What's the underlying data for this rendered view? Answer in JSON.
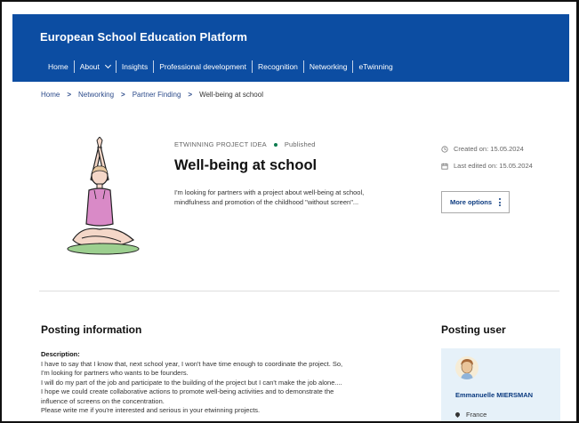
{
  "header": {
    "site_title": "European School Education Platform",
    "nav": [
      {
        "label": "Home"
      },
      {
        "label": "About",
        "has_dropdown": true
      },
      {
        "label": "Insights"
      },
      {
        "label": "Professional development"
      },
      {
        "label": "Recognition"
      },
      {
        "label": "Networking"
      },
      {
        "label": "eTwinning"
      }
    ],
    "brand_color": "#0c4da2"
  },
  "breadcrumb": {
    "items": [
      "Home",
      "Networking",
      "Partner Finding"
    ],
    "current": "Well-being at school"
  },
  "project": {
    "kicker": "ETWINNING PROJECT IDEA",
    "status": "Published",
    "title": "Well-being at school",
    "summary": "I'm looking for partners with a project about well-being at school, mindfulness and promotion of the childhood \"without screen\"...",
    "illustration_icon": "yoga-meditation-figure",
    "created": "Created on: 15.05.2024",
    "edited": "Last edited on: 15.05.2024",
    "more_options_label": "More options"
  },
  "posting_info": {
    "title": "Posting information",
    "description_label": "Description:",
    "description_lines": [
      "I have to say that I know that, next school year, I won't have time enough to coordinate the project. So,",
      "I'm looking for partners who wants to be founders.",
      "I will do my part of the job and participate to the building of the project but I can't make the job alone....",
      "I hope we could create collaborative actions to promote well-being activities and to demonstrate the",
      "influence of screens on the concentration.",
      "Please write me if you're interested and serious in your etwinning projects."
    ]
  },
  "posting_user": {
    "title": "Posting user",
    "name": "Emmanuelle MIERSMAN",
    "country": "France",
    "card_color": "#e6f1f9"
  }
}
